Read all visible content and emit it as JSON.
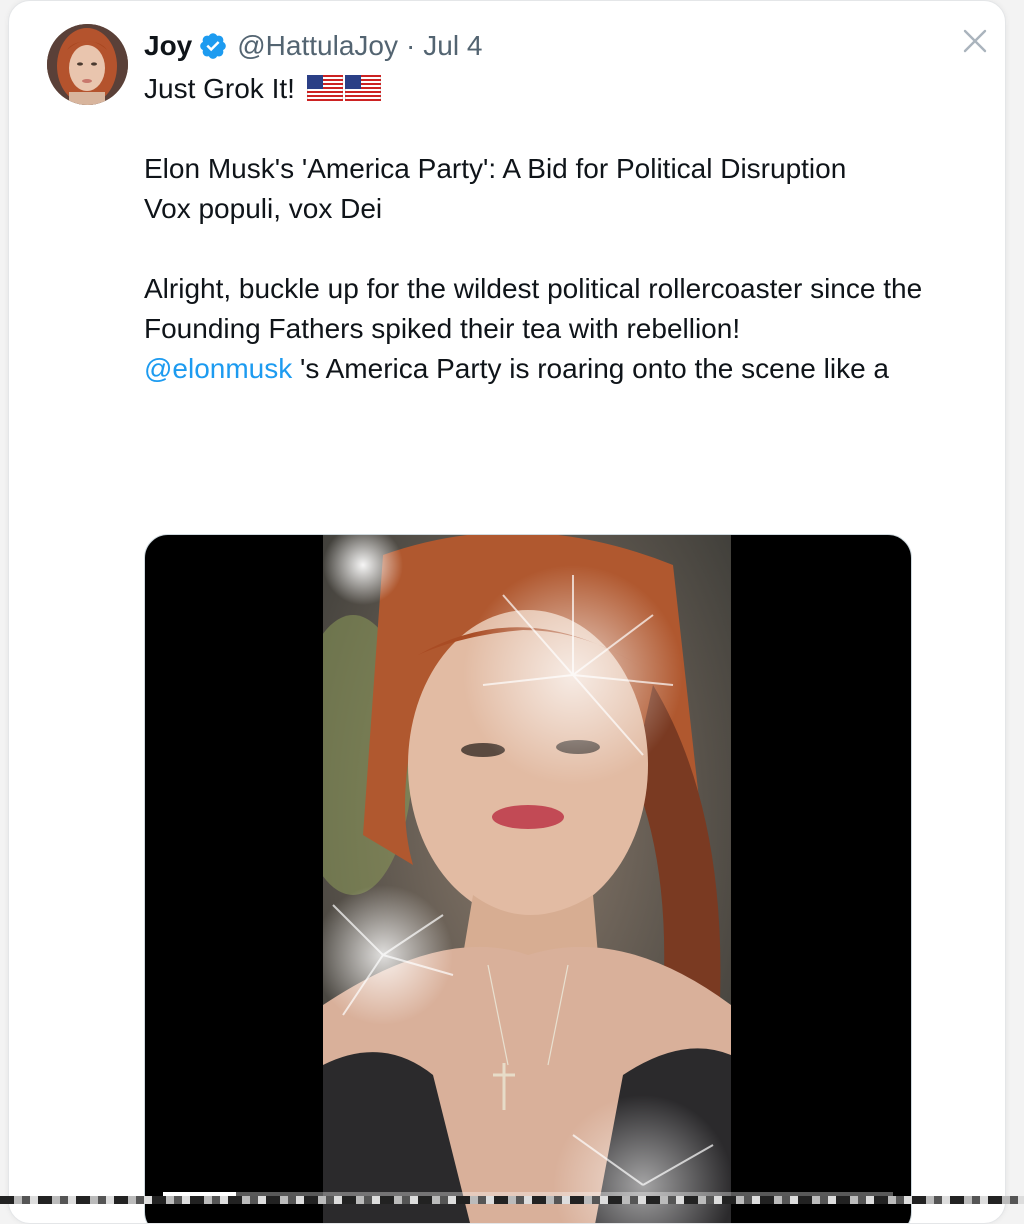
{
  "tweet": {
    "author_name": "Joy",
    "handle": "@HattulaJoy",
    "separator": "·",
    "date": "Jul 4",
    "verified": true,
    "line1": "Just Grok It!",
    "line1_emoji": [
      "flag-us",
      "flag-us"
    ],
    "headline": "Elon Musk's 'America Party': A Bid for Political Disruption",
    "motto": "Vox populi, vox Dei",
    "body": "Alright, buckle up for the wildest political rollercoaster since the Founding Fathers spiked their tea with rebellion!",
    "mention": "@elonmusk",
    "after_mention": " 's America Party is roaring onto the scene like a"
  },
  "icons": {
    "verified": "verified-badge-icon",
    "close": "close-icon"
  },
  "media": {
    "type": "video",
    "progress": 0.1
  },
  "colors": {
    "link": "#1d9bf0",
    "verified": "#1d9bf0",
    "text": "#0f1419",
    "muted": "#536471"
  }
}
